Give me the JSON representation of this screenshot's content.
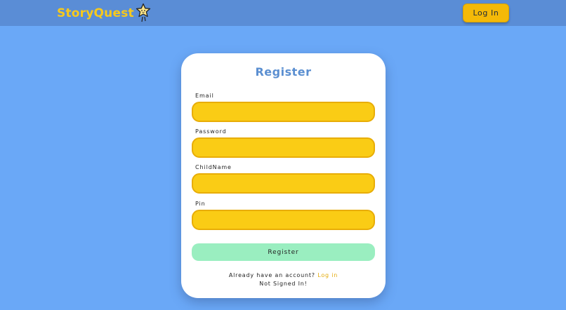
{
  "app": {
    "name": "StoryQuest",
    "logo_icon": "star-icon",
    "colors": {
      "background": "#6aa8f7",
      "navbar": "#5a8dd6",
      "accent": "#facc15",
      "title": "#5b8fd1",
      "submit": "#9aeec0",
      "link": "#e4ab0b"
    }
  },
  "navbar": {
    "login_label": "Log In"
  },
  "form": {
    "title": "Register",
    "fields": [
      {
        "label": "Email",
        "value": "",
        "placeholder": ""
      },
      {
        "label": "Password",
        "value": "",
        "placeholder": ""
      },
      {
        "label": "ChildName",
        "value": "",
        "placeholder": ""
      },
      {
        "label": "Pin",
        "value": "",
        "placeholder": ""
      }
    ],
    "submit_label": "Register",
    "account_prompt": "Already have an account?",
    "login_link": "Log in",
    "status": "Not Signed In!"
  }
}
